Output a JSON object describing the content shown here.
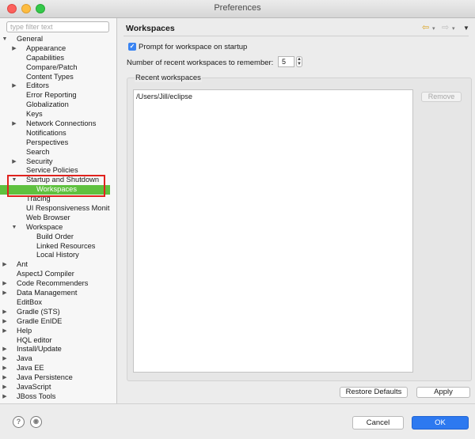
{
  "window": {
    "title": "Preferences"
  },
  "sidebar": {
    "filter_placeholder": "type filter text",
    "items": [
      {
        "label": "General",
        "level": 0,
        "twisty": "open"
      },
      {
        "label": "Appearance",
        "level": 1,
        "twisty": "closed"
      },
      {
        "label": "Capabilities",
        "level": 1,
        "twisty": ""
      },
      {
        "label": "Compare/Patch",
        "level": 1,
        "twisty": ""
      },
      {
        "label": "Content Types",
        "level": 1,
        "twisty": ""
      },
      {
        "label": "Editors",
        "level": 1,
        "twisty": "closed"
      },
      {
        "label": "Error Reporting",
        "level": 1,
        "twisty": ""
      },
      {
        "label": "Globalization",
        "level": 1,
        "twisty": ""
      },
      {
        "label": "Keys",
        "level": 1,
        "twisty": ""
      },
      {
        "label": "Network Connections",
        "level": 1,
        "twisty": "closed"
      },
      {
        "label": "Notifications",
        "level": 1,
        "twisty": ""
      },
      {
        "label": "Perspectives",
        "level": 1,
        "twisty": ""
      },
      {
        "label": "Search",
        "level": 1,
        "twisty": ""
      },
      {
        "label": "Security",
        "level": 1,
        "twisty": "closed"
      },
      {
        "label": "Service Policies",
        "level": 1,
        "twisty": ""
      },
      {
        "label": "Startup and Shutdown",
        "level": 1,
        "twisty": "open"
      },
      {
        "label": "Workspaces",
        "level": 2,
        "twisty": "",
        "selected": true
      },
      {
        "label": "Tracing",
        "level": 1,
        "twisty": ""
      },
      {
        "label": "UI Responsiveness Monit",
        "level": 1,
        "twisty": ""
      },
      {
        "label": "Web Browser",
        "level": 1,
        "twisty": ""
      },
      {
        "label": "Workspace",
        "level": 1,
        "twisty": "open"
      },
      {
        "label": "Build Order",
        "level": 2,
        "twisty": ""
      },
      {
        "label": "Linked Resources",
        "level": 2,
        "twisty": ""
      },
      {
        "label": "Local History",
        "level": 2,
        "twisty": ""
      },
      {
        "label": "Ant",
        "level": 0,
        "twisty": "closed"
      },
      {
        "label": "AspectJ Compiler",
        "level": 0,
        "twisty": ""
      },
      {
        "label": "Code Recommenders",
        "level": 0,
        "twisty": "closed"
      },
      {
        "label": "Data Management",
        "level": 0,
        "twisty": "closed"
      },
      {
        "label": "EditBox",
        "level": 0,
        "twisty": ""
      },
      {
        "label": "Gradle (STS)",
        "level": 0,
        "twisty": "closed"
      },
      {
        "label": "Gradle EnIDE",
        "level": 0,
        "twisty": "closed"
      },
      {
        "label": "Help",
        "level": 0,
        "twisty": "closed"
      },
      {
        "label": "HQL editor",
        "level": 0,
        "twisty": ""
      },
      {
        "label": "Install/Update",
        "level": 0,
        "twisty": "closed"
      },
      {
        "label": "Java",
        "level": 0,
        "twisty": "closed"
      },
      {
        "label": "Java EE",
        "level": 0,
        "twisty": "closed"
      },
      {
        "label": "Java Persistence",
        "level": 0,
        "twisty": "closed"
      },
      {
        "label": "JavaScript",
        "level": 0,
        "twisty": "closed"
      },
      {
        "label": "JBoss Tools",
        "level": 0,
        "twisty": "closed"
      }
    ]
  },
  "page": {
    "title": "Workspaces",
    "prompt_checkbox_label": "Prompt for workspace on startup",
    "prompt_checked": true,
    "recent_count_label": "Number of recent workspaces to remember:",
    "recent_count_value": "5",
    "recent_group_label": "Recent workspaces",
    "recent_workspaces": [
      "/Users/Jill/eclipse"
    ],
    "remove_label": "Remove",
    "restore_defaults_label": "Restore Defaults",
    "apply_label": "Apply"
  },
  "footer": {
    "help_icon_glyph": "?",
    "import_icon_glyph": "◉",
    "cancel_label": "Cancel",
    "ok_label": "OK"
  },
  "colors": {
    "selection": "#5fc13f",
    "highlight_box": "#e0221e",
    "primary_button": "#2d79f0",
    "checkbox": "#3a84f2"
  }
}
